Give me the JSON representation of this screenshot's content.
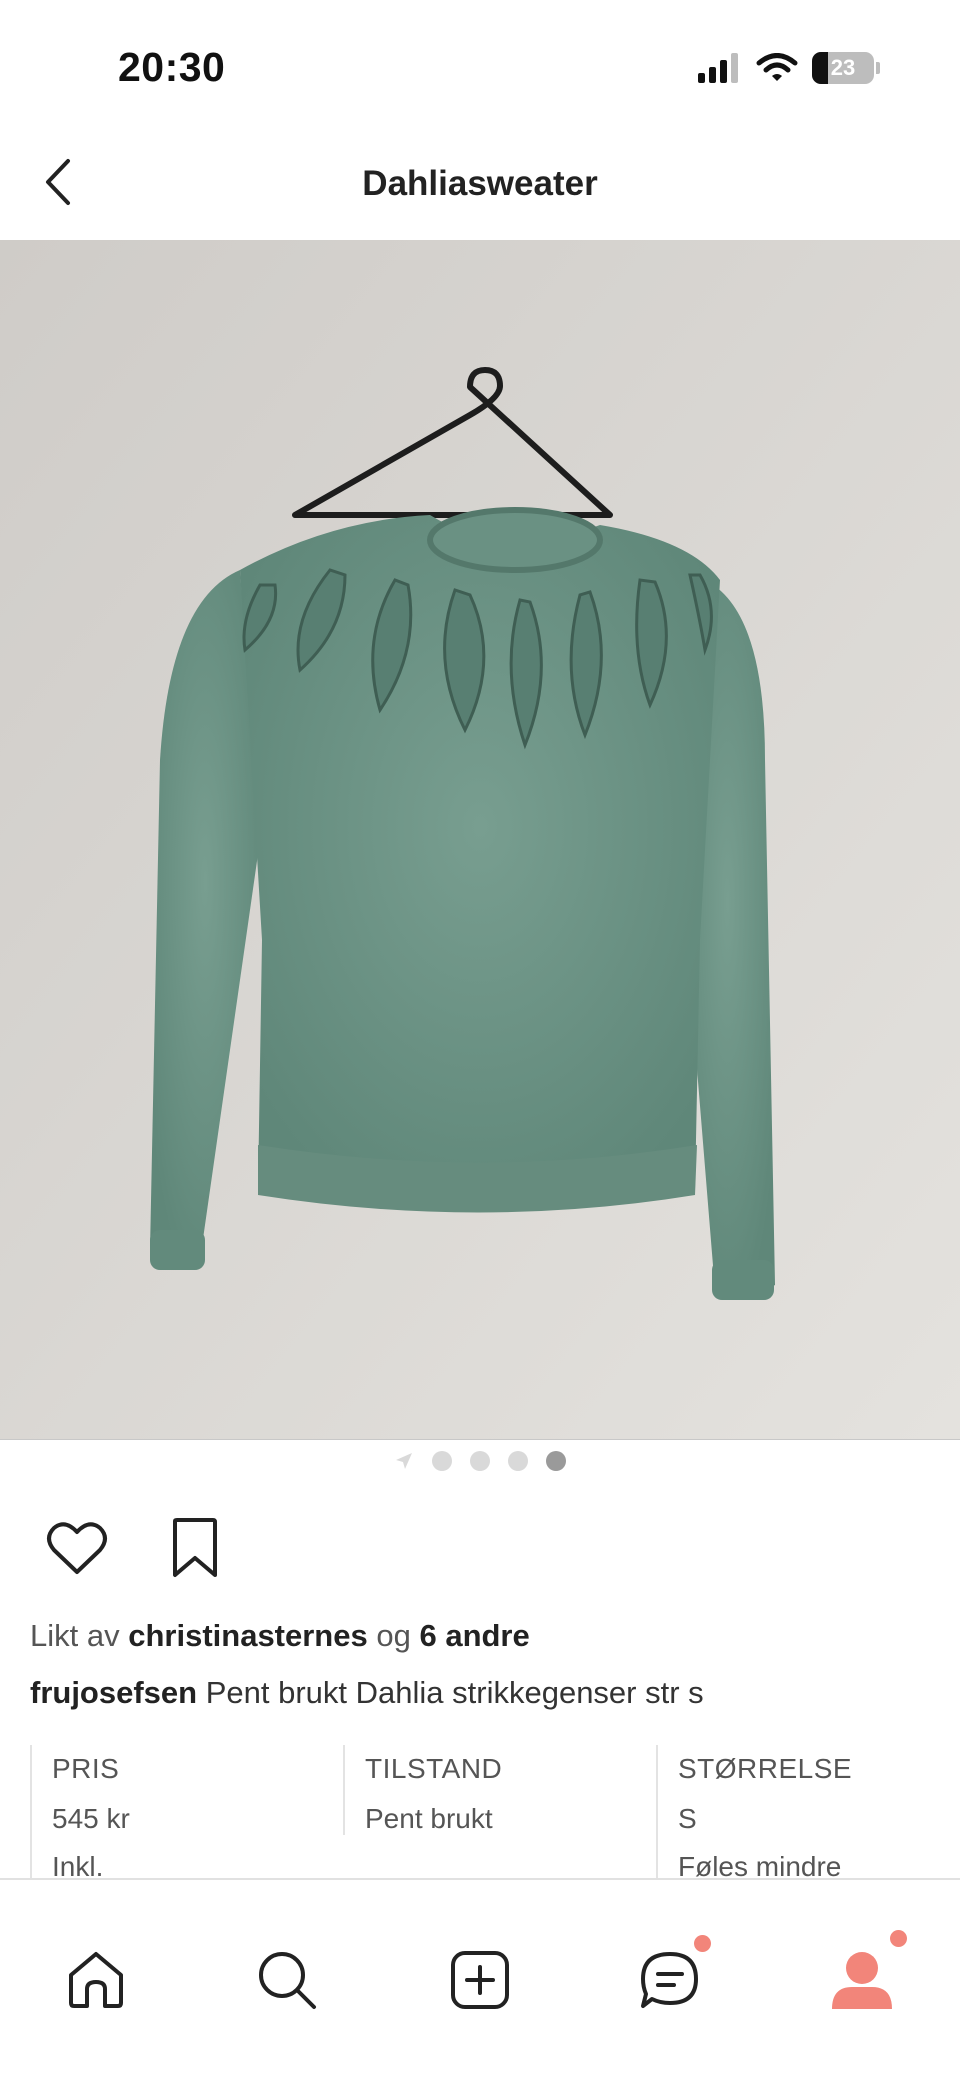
{
  "status_bar": {
    "time": "20:30",
    "battery": "23"
  },
  "header": {
    "title": "Dahliasweater"
  },
  "pager": {
    "count": 4,
    "active_index": 3
  },
  "likes": {
    "prefix": "Likt av",
    "user": "christinasternes",
    "conjunction": "og",
    "others": "6 andre"
  },
  "caption": {
    "user": "frujosefsen",
    "text": "Pent brukt Dahlia strikkegenser str s"
  },
  "details": {
    "price": {
      "label": "PRIS",
      "value": "545 kr",
      "link": "Inkl."
    },
    "condition": {
      "label": "TILSTAND",
      "value": "Pent brukt"
    },
    "size": {
      "label": "STØRRELSE",
      "value": "S",
      "link": "Føles mindre"
    }
  },
  "tab_bar": {
    "items": [
      "home-icon",
      "search-icon",
      "add-icon",
      "chat-icon",
      "profile-icon"
    ]
  },
  "colors": {
    "accent": "#f2857a",
    "sweater": "#6e9687",
    "wall": "#d9d7d3"
  }
}
